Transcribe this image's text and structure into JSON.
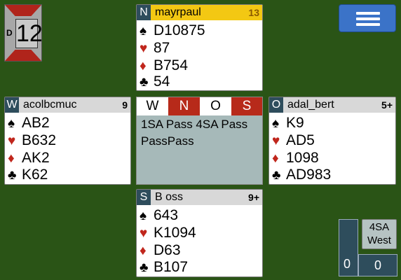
{
  "board": {
    "number": "12",
    "dealer": "D"
  },
  "menu": {
    "icon": "hamburger-menu-icon"
  },
  "north": {
    "seat": "N",
    "name": "mayrpaul",
    "hcp": "13",
    "spades": "D10875",
    "hearts": "87",
    "diamonds": "B754",
    "clubs": "54"
  },
  "west": {
    "seat": "W",
    "name": "acolbcmuc",
    "hcp": "9",
    "spades": "AB2",
    "hearts": "B632",
    "diamonds": "AK2",
    "clubs": "K62"
  },
  "east": {
    "seat": "O",
    "name": "adal_bert",
    "hcp": "5+",
    "spades": "K9",
    "hearts": "AD5",
    "diamonds": "1098",
    "clubs": "AD983"
  },
  "south": {
    "seat": "S",
    "name": "B oss",
    "hcp": "9+",
    "spades": "643",
    "hearts": "K1094",
    "diamonds": "D63",
    "clubs": "B107"
  },
  "suits": {
    "spade": "♠",
    "heart": "♥",
    "diamond": "♦",
    "club": "♣"
  },
  "bidding": {
    "headers": [
      "W",
      "N",
      "O",
      "S"
    ],
    "row1": "1SA Pass 4SA Pass",
    "row2": "PassPass"
  },
  "score": {
    "ns": "0",
    "ew": "0"
  },
  "contract": {
    "bid": "4SA",
    "declarer": "West"
  },
  "colors": {
    "table": "#2a5416",
    "vulnerable": "#b0241b",
    "active_player": "#f3c813",
    "seat_badge": "#2e4d5c",
    "red_suit": "#c0261c",
    "menu_button": "#3b73c8"
  }
}
